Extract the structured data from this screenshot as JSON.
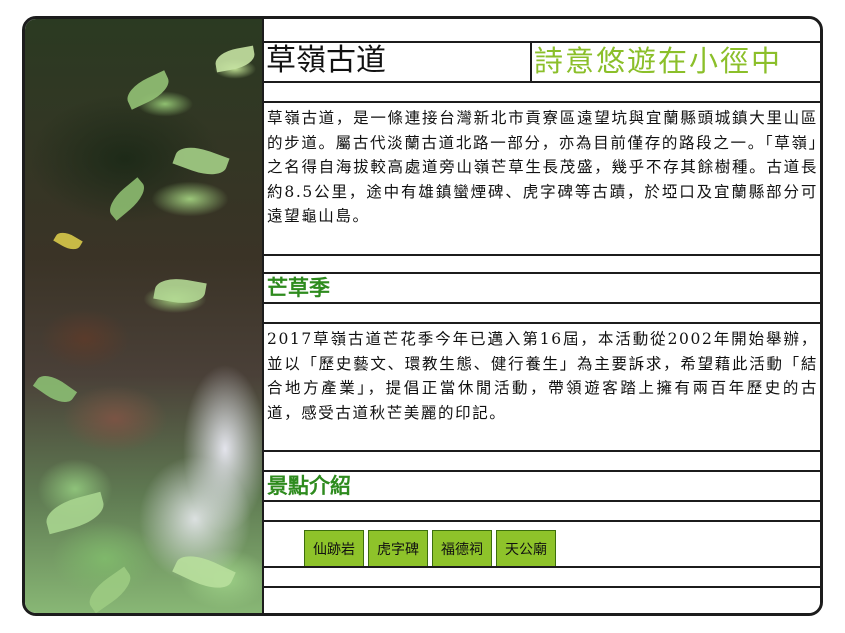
{
  "header": {
    "title": "草嶺古道",
    "slogan": "詩意悠遊在小徑中"
  },
  "intro": {
    "text": "草嶺古道，是一條連接台灣新北市貢寮區遠望坑與宜蘭縣頭城鎮大里山區的步道。屬古代淡蘭古道北路一部分，亦為目前僅存的路段之一。「草嶺」之名得自海拔較高處道旁山嶺芒草生長茂盛，幾乎不存其餘樹種。古道長約8.5公里，途中有雄鎮蠻煙碑、虎字碑等古蹟，於埡口及宜蘭縣部分可遠望龜山島。"
  },
  "festival": {
    "heading": "芒草季",
    "text": "2017草嶺古道芒花季今年已邁入第16屆，本活動從2002年開始舉辦，並以「歷史藝文、環教生態、健行養生」為主要訴求，希望藉此活動「結合地方產業」，提倡正當休閒活動，帶領遊客踏上擁有兩百年歷史的古道，感受古道秋芒美麗的印記。"
  },
  "spots": {
    "heading": "景點介紹",
    "buttons": [
      "仙跡岩",
      "虎字碑",
      "福德祠",
      "天公廟"
    ]
  },
  "colors": {
    "slogan": "#8bbf2a",
    "section_heading": "#2e8b1e",
    "button_bg": "#8ec32a",
    "border": "#1c1c1c"
  }
}
